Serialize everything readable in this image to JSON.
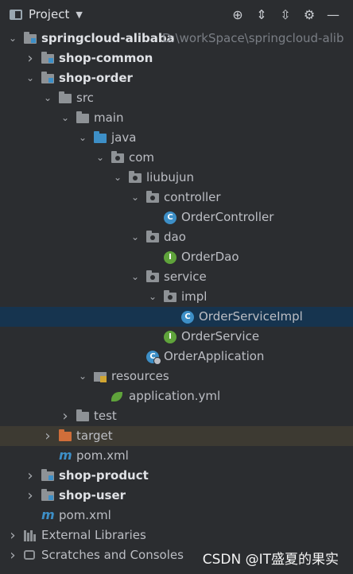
{
  "toolbar": {
    "title": "Project",
    "icons": [
      "locate-icon",
      "expand-all-icon",
      "collapse-all-icon",
      "settings-icon",
      "hide-icon"
    ]
  },
  "tree": [
    {
      "depth": 0,
      "chevron": "down",
      "icon": "module-folder",
      "label": "springcloud-alibaba",
      "bold": true,
      "path": "D:\\workSpace\\springcloud-alib"
    },
    {
      "depth": 1,
      "chevron": "right",
      "icon": "module-folder",
      "label": "shop-common",
      "bold": true
    },
    {
      "depth": 1,
      "chevron": "down",
      "icon": "module-folder",
      "label": "shop-order",
      "bold": true
    },
    {
      "depth": 2,
      "chevron": "down",
      "icon": "folder",
      "label": "src"
    },
    {
      "depth": 3,
      "chevron": "down",
      "icon": "folder",
      "label": "main"
    },
    {
      "depth": 4,
      "chevron": "down",
      "icon": "source-folder",
      "label": "java"
    },
    {
      "depth": 5,
      "chevron": "down",
      "icon": "package",
      "label": "com"
    },
    {
      "depth": 6,
      "chevron": "down",
      "icon": "package",
      "label": "liubujun"
    },
    {
      "depth": 7,
      "chevron": "down",
      "icon": "package",
      "label": "controller"
    },
    {
      "depth": 8,
      "chevron": "none",
      "icon": "class",
      "label": "OrderController"
    },
    {
      "depth": 7,
      "chevron": "down",
      "icon": "package",
      "label": "dao"
    },
    {
      "depth": 8,
      "chevron": "none",
      "icon": "interface",
      "label": "OrderDao"
    },
    {
      "depth": 7,
      "chevron": "down",
      "icon": "package",
      "label": "service"
    },
    {
      "depth": 8,
      "chevron": "down",
      "icon": "package",
      "label": "impl"
    },
    {
      "depth": 9,
      "chevron": "none",
      "icon": "class",
      "label": "OrderServiceImpl",
      "selected": true
    },
    {
      "depth": 8,
      "chevron": "none",
      "icon": "interface",
      "label": "OrderService"
    },
    {
      "depth": 7,
      "chevron": "none",
      "icon": "spring-app",
      "label": "OrderApplication"
    },
    {
      "depth": 4,
      "chevron": "down",
      "icon": "resources-folder",
      "label": "resources"
    },
    {
      "depth": 5,
      "chevron": "none",
      "icon": "yml",
      "label": "application.yml"
    },
    {
      "depth": 3,
      "chevron": "right",
      "icon": "folder",
      "label": "test"
    },
    {
      "depth": 2,
      "chevron": "right",
      "icon": "excluded-folder",
      "label": "target",
      "excluded": true
    },
    {
      "depth": 2,
      "chevron": "none",
      "icon": "maven",
      "label": "pom.xml"
    },
    {
      "depth": 1,
      "chevron": "right",
      "icon": "module-folder",
      "label": "shop-product",
      "bold": true
    },
    {
      "depth": 1,
      "chevron": "right",
      "icon": "module-folder",
      "label": "shop-user",
      "bold": true
    },
    {
      "depth": 1,
      "chevron": "none",
      "icon": "maven",
      "label": "pom.xml"
    },
    {
      "depth": 0,
      "chevron": "right",
      "icon": "libraries",
      "label": "External Libraries"
    },
    {
      "depth": 0,
      "chevron": "right",
      "icon": "scratches",
      "label": "Scratches and Consoles"
    }
  ],
  "watermark": "CSDN @IT盛夏的果实"
}
